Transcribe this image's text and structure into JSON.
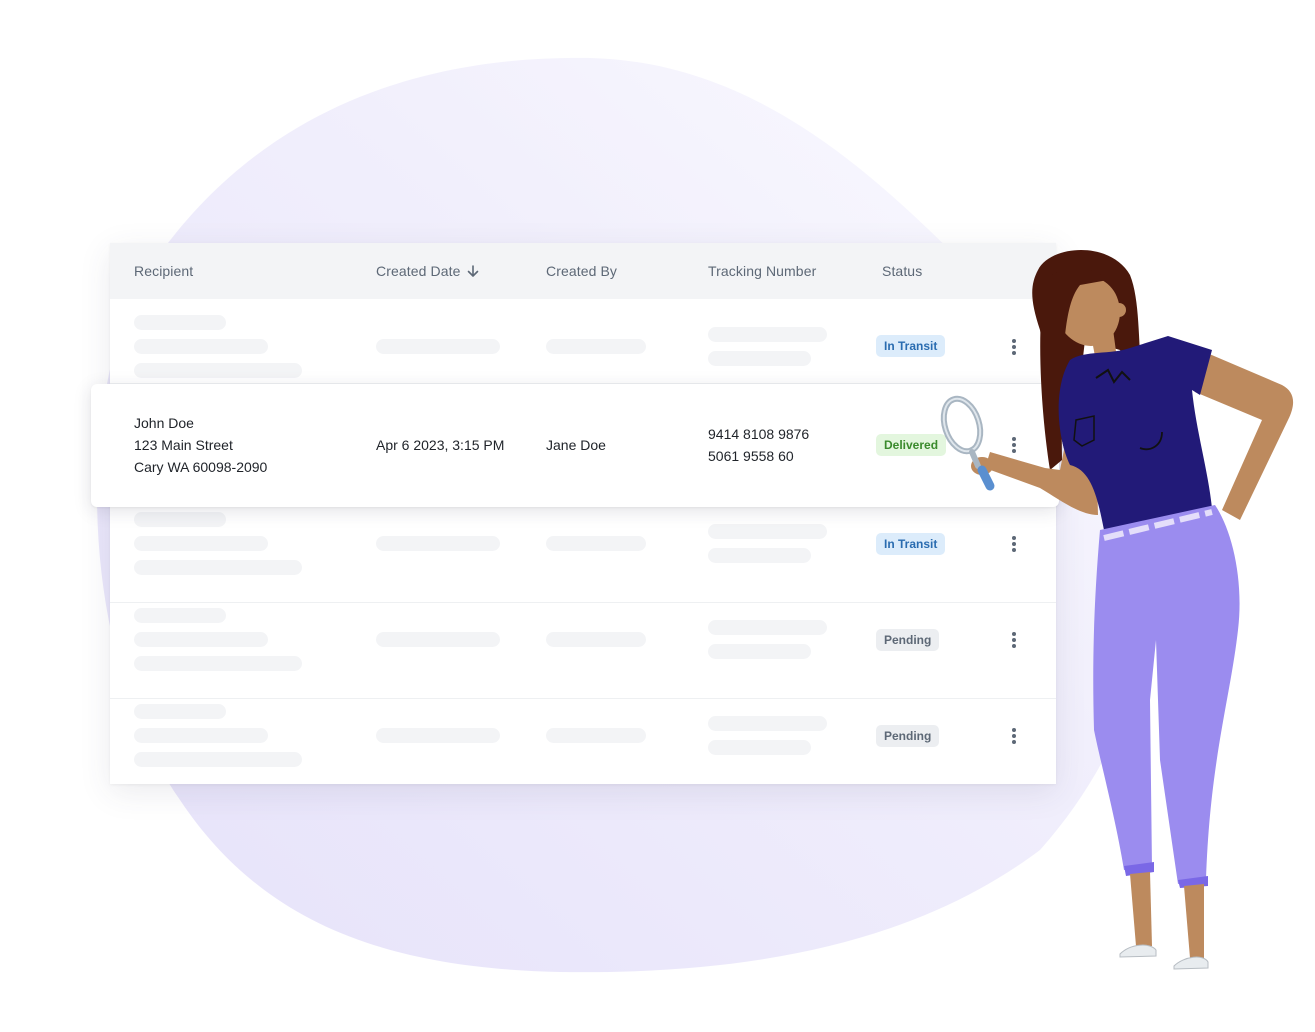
{
  "table": {
    "columns": [
      {
        "label": "Recipient"
      },
      {
        "label": "Created Date",
        "sort": "descending",
        "sort_icon": "arrow-down-icon"
      },
      {
        "label": "Created By"
      },
      {
        "label": "Tracking Number"
      },
      {
        "label": "Status"
      }
    ],
    "rows": [
      {
        "loading": true,
        "status": "In Transit",
        "status_type": "transit"
      },
      {
        "loading": false,
        "recipient": {
          "name": "John Doe",
          "street": "123 Main Street",
          "city": "Cary WA 60098-2090"
        },
        "created_date": "Apr 6 2023, 3:15 PM",
        "created_by": "Jane Doe",
        "tracking_number": [
          "9414 8108 9876",
          "5061 9558 60"
        ],
        "status": "Delivered",
        "status_type": "delivered"
      },
      {
        "loading": true,
        "status": "In Transit",
        "status_type": "transit"
      },
      {
        "loading": true,
        "status": "Pending",
        "status_type": "pending"
      },
      {
        "loading": true,
        "status": "Pending",
        "status_type": "pending"
      }
    ],
    "row_menu_icon": "kebab-menu-icon"
  },
  "colors": {
    "header_bg": "#f3f4f6",
    "skeleton": "#f3f4f6",
    "transit_bg": "#dcecfb",
    "transit_fg": "#2a6cb0",
    "delivered_bg": "#e3f6de",
    "delivered_fg": "#3a8a2c",
    "pending_bg": "#eceef1",
    "pending_fg": "#5d6876",
    "blob": "#ece9fb",
    "shirt": "#221a78",
    "pants": "#9b8cef",
    "hair": "#4a180c",
    "skin": "#bd8a5e"
  },
  "illustration": {
    "subject": "woman-with-magnifying-glass",
    "icon": "magnifying-glass-icon"
  }
}
